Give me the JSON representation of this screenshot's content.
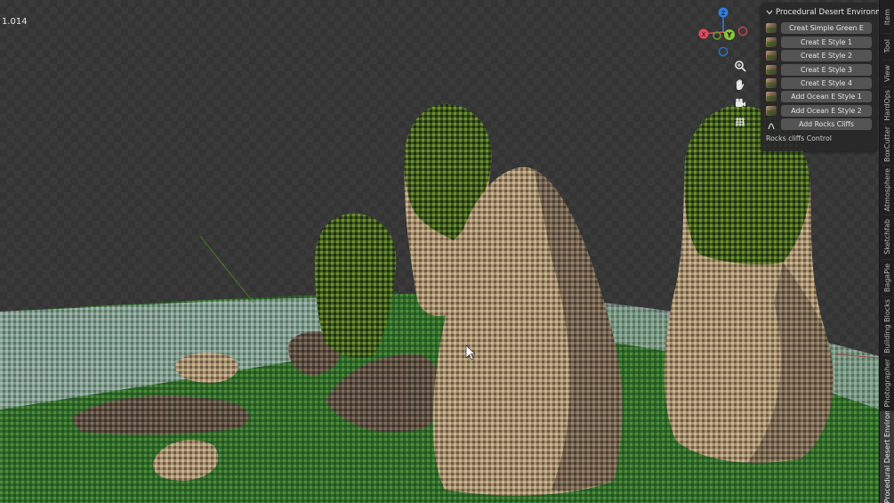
{
  "viewport": {
    "readout_value": "1.014"
  },
  "gizmo": {
    "axes": [
      {
        "label": "Z",
        "color": "#2d7fe2"
      },
      {
        "label": "Y",
        "color": "#8cc43c"
      },
      {
        "label": "X",
        "color": "#e8475a"
      }
    ],
    "tools": [
      "zoom-icon",
      "hand-pan-icon",
      "camera-icon",
      "grid-icon"
    ]
  },
  "panel": {
    "title": "Procedural Desert Environment",
    "buttons": [
      {
        "label": "Creat Simple Green E",
        "icon": "thumbnail-icon"
      },
      {
        "label": "Creat E Style 1",
        "icon": "thumbnail-icon"
      },
      {
        "label": "Creat E Style 2",
        "icon": "thumbnail-icon"
      },
      {
        "label": "Creat E Style 3",
        "icon": "thumbnail-icon"
      },
      {
        "label": "Creat E Style 4",
        "icon": "thumbnail-icon"
      },
      {
        "label": "Add Ocean E Style 1",
        "icon": "thumbnail-icon"
      },
      {
        "label": "Add Ocean E Style 2",
        "icon": "thumbnail-icon"
      },
      {
        "label": "Add Rocks Cliffs",
        "icon": "curve-icon"
      }
    ],
    "sublabel": "Rocks cliffs Control"
  },
  "tabs": [
    {
      "label": "Item",
      "active": false
    },
    {
      "label": "Tool",
      "active": false
    },
    {
      "label": "View",
      "active": false
    },
    {
      "label": "HardOps",
      "active": false
    },
    {
      "label": "BoxCutter",
      "active": false
    },
    {
      "label": "Atmosphere",
      "active": false
    },
    {
      "label": "Sketchfab",
      "active": false
    },
    {
      "label": "BagaPie",
      "active": false
    },
    {
      "label": "Building Blocks",
      "active": false
    },
    {
      "label": "Photographer",
      "active": false
    },
    {
      "label": "Procedural Desert Environment",
      "active": true
    }
  ]
}
